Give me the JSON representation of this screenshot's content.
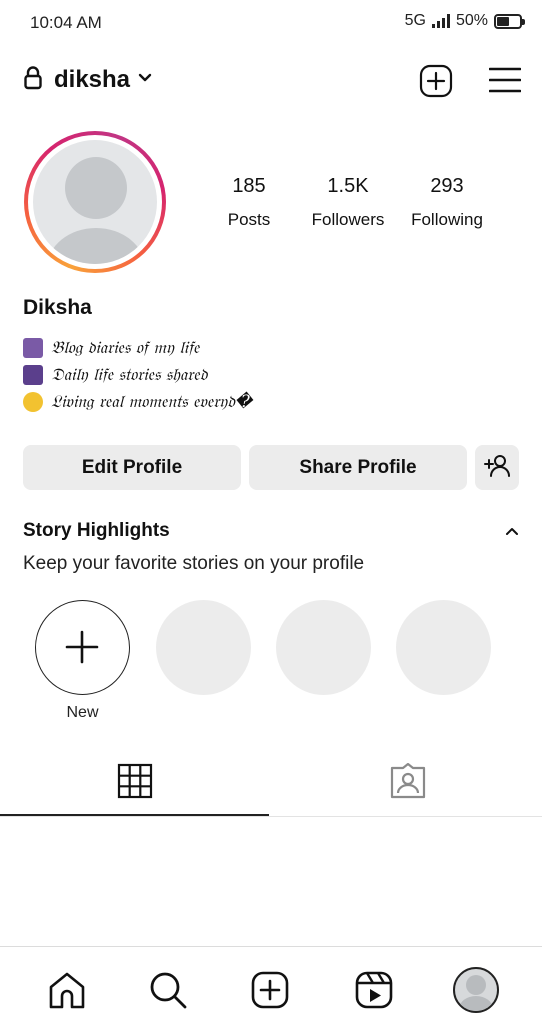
{
  "status_bar": {
    "time": "10:04 AM",
    "network": "5G",
    "battery": "50%",
    "battery_level": 0.5
  },
  "header": {
    "username": "diksha",
    "icons": [
      "lock-icon",
      "chevron-down-icon",
      "create-plus-icon",
      "menu-icon"
    ]
  },
  "profile": {
    "display_name": "Diksha",
    "stats": [
      {
        "value": "185",
        "label": "Posts"
      },
      {
        "value": "1.5K",
        "label": "Followers"
      },
      {
        "value": "293",
        "label": "Following"
      }
    ],
    "bio": [
      "𝔅𝔩𝔬𝔤 𝔡𝔦𝔞𝔯𝔦𝔢𝔰 𝔬𝔣 𝔪𝔶 𝔩𝔦𝔣𝔢",
      "𝔇𝔞𝔦𝔩𝔶 𝔩𝔦𝔣𝔢 𝔰𝔱𝔬𝔯𝔦𝔢𝔰 𝔰𝔥𝔞𝔯𝔢𝔡",
      "𝔏𝔦𝔳𝔦𝔫𝔤 𝔯𝔢𝔞𝔩 𝔪𝔬𝔪𝔢𝔫𝔱𝔰 𝔢𝔳𝔢𝔯𝔶𝔡�"
    ],
    "bio_icons": [
      "camera-icon",
      "city-night-icon",
      "dizzy-star-icon"
    ],
    "ring_colors": [
      "#f9a23a",
      "#f56040",
      "#d6246e",
      "#c13584"
    ]
  },
  "actions": {
    "edit_profile": "Edit Profile",
    "share_profile": "Share Profile"
  },
  "highlights": {
    "title": "Story Highlights",
    "subtitle": "Keep your favorite stories on your profile",
    "new_label": "New"
  },
  "tabs": {
    "icons": [
      "grid-icon",
      "tagged-icon"
    ],
    "active": "grid"
  },
  "bottom_nav": {
    "icons": [
      "home-icon",
      "search-icon",
      "create-icon",
      "reels-icon",
      "profile-avatar-icon"
    ]
  },
  "colors": {
    "button_bg": "#ececec",
    "placeholder_bg": "#ececec",
    "text": "#111111"
  }
}
